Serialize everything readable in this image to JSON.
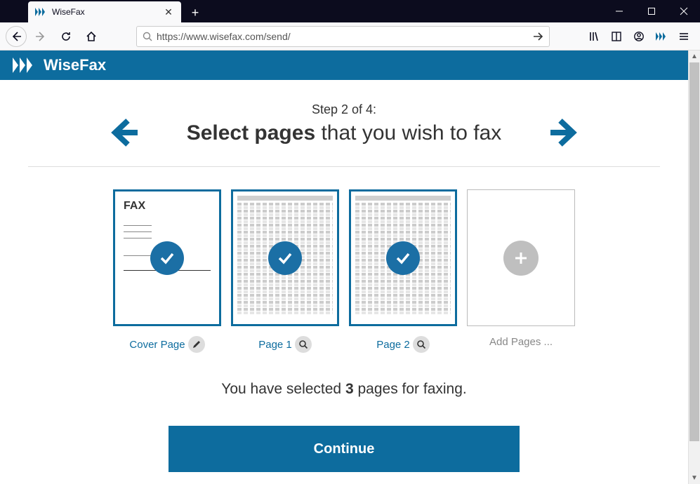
{
  "browser": {
    "tab_title": "WiseFax",
    "url": "https://www.wisefax.com/send/"
  },
  "app": {
    "logo_text": "WiseFax"
  },
  "wizard": {
    "step_text": "Step 2 of 4:",
    "title_bold": "Select pages",
    "title_rest": " that you wish to fax"
  },
  "pages": [
    {
      "label": "Cover Page",
      "action": "edit",
      "doc_header": "FAX"
    },
    {
      "label": "Page 1",
      "action": "zoom"
    },
    {
      "label": "Page 2",
      "action": "zoom"
    }
  ],
  "add_pages_label": "Add Pages ...",
  "summary": {
    "prefix": "You have selected ",
    "count": "3",
    "suffix": " pages for faxing."
  },
  "continue_label": "Continue"
}
